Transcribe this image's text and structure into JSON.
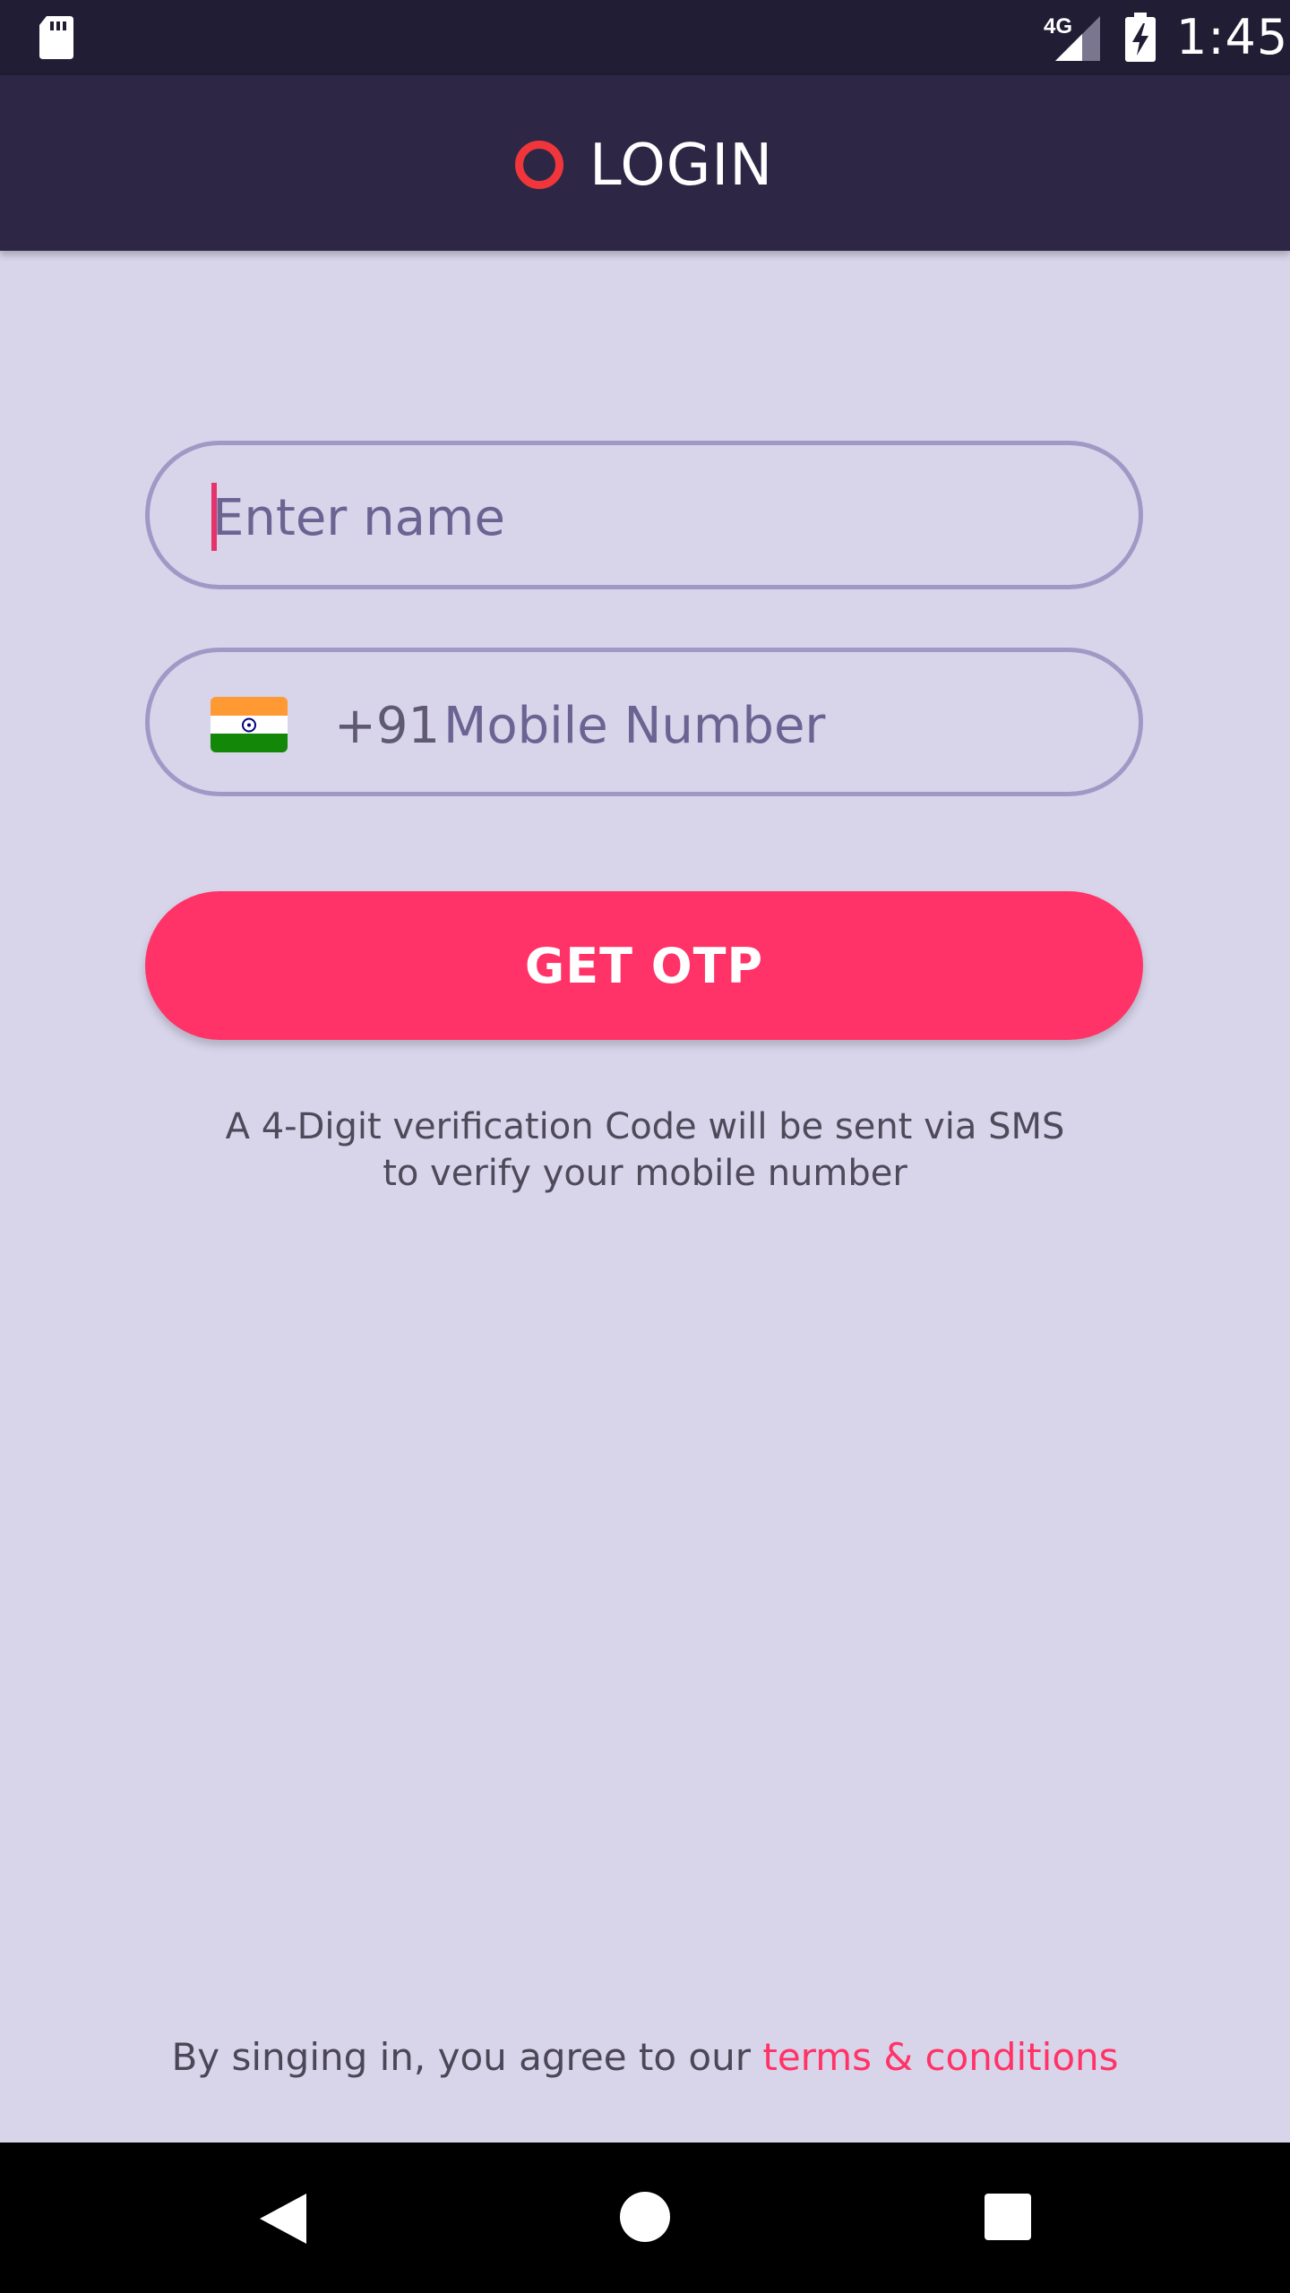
{
  "status_bar": {
    "network": "4G",
    "time": "1:45",
    "icons": [
      "sd-card-icon",
      "signal-icon",
      "battery-charging-icon"
    ]
  },
  "app_bar": {
    "title": "LOGIN",
    "logo_icon": "ring-logo-icon",
    "logo_color": "#f0363b"
  },
  "form": {
    "name_placeholder": "Enter name",
    "name_value": "",
    "country_flag": "india-flag-icon",
    "country_code": "+91",
    "mobile_placeholder": "Mobile Number",
    "mobile_value": ""
  },
  "actions": {
    "get_otp_label": "GET OTP"
  },
  "info": {
    "line1": "A 4-Digit verification Code will be sent via SMS",
    "line2": "to verify your mobile number"
  },
  "footer": {
    "terms_prefix": "By singing in, you agree to our ",
    "terms_link": "terms & conditions"
  },
  "nav_bar": {
    "icons": [
      "back-icon",
      "home-icon",
      "recents-icon"
    ]
  },
  "colors": {
    "background": "#d8d4ea",
    "app_bar": "#2d2745",
    "accent": "#ff3367",
    "field_border": "#9f99c6"
  }
}
